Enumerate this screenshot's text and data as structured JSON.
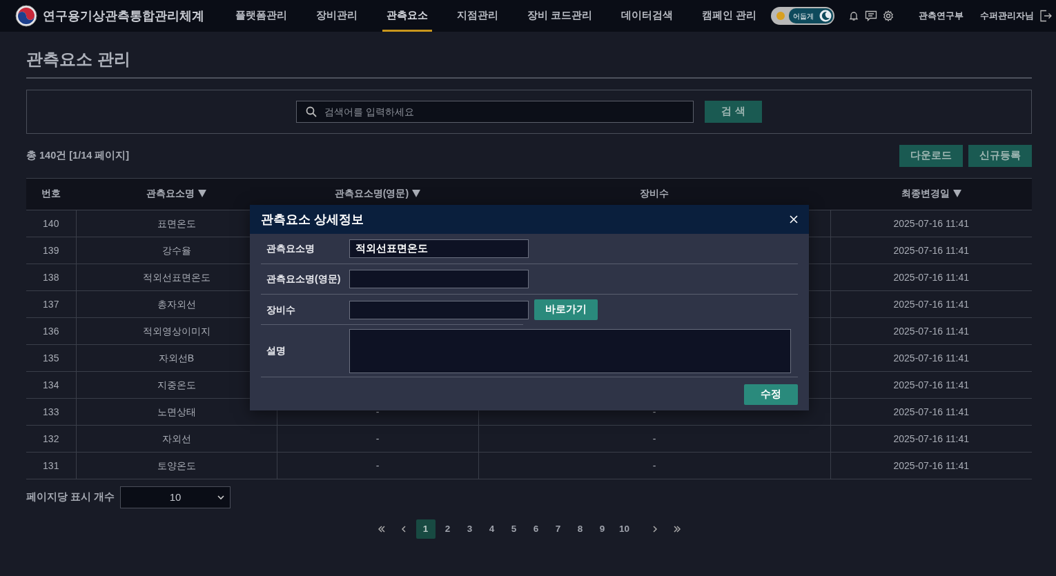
{
  "app": {
    "title": "연구용기상관측통합관리체계"
  },
  "nav": [
    {
      "label": "플랫폼관리",
      "selected": false
    },
    {
      "label": "장비관리",
      "selected": false
    },
    {
      "label": "관측요소",
      "selected": true
    },
    {
      "label": "지점관리",
      "selected": false
    },
    {
      "label": "장비 코드관리",
      "selected": false
    },
    {
      "label": "데이터검색",
      "selected": false
    },
    {
      "label": "캠페인 관리",
      "selected": false
    }
  ],
  "theme_toggle": {
    "label": "어둡게",
    "dark": true
  },
  "user": {
    "department": "관측연구부",
    "name": "수퍼관리자님"
  },
  "page_title": "관측요소 관리",
  "search": {
    "placeholder": "검색어를 입력하세요",
    "button": "검 색"
  },
  "summary": "총 140건 [1/14 페이지]",
  "actions": [
    "다운로드",
    "신규등록"
  ],
  "table": {
    "columns": [
      {
        "label": "번호",
        "sortable": false
      },
      {
        "label": "관측요소명",
        "sortable": true
      },
      {
        "label": "관측요소명(영문)",
        "sortable": true
      },
      {
        "label": "장비수",
        "sortable": false
      },
      {
        "label": "최종변경일",
        "sortable": true
      }
    ],
    "rows": [
      {
        "no": "140",
        "name": "표면온도",
        "updated": "2025-07-16 11:41"
      },
      {
        "no": "139",
        "name": "강수율",
        "updated": "2025-07-16 11:41"
      },
      {
        "no": "138",
        "name": "적외선표면온도",
        "updated": "2025-07-16 11:41"
      },
      {
        "no": "137",
        "name": "총자외선",
        "updated": "2025-07-16 11:41"
      },
      {
        "no": "136",
        "name": "적외영상이미지",
        "updated": "2025-07-16 11:41"
      },
      {
        "no": "135",
        "name": "자외선B",
        "updated": "2025-07-16 11:41"
      },
      {
        "no": "134",
        "name": "지중온도",
        "updated": "2025-07-16 11:41"
      },
      {
        "no": "133",
        "name": "노면상태",
        "name_en": "-",
        "devices": "-",
        "updated": "2025-07-16 11:41"
      },
      {
        "no": "132",
        "name": "자외선",
        "name_en": "-",
        "devices": "-",
        "updated": "2025-07-16 11:41"
      },
      {
        "no": "131",
        "name": "토양온도",
        "name_en": "-",
        "devices": "-",
        "updated": "2025-07-16 11:41"
      }
    ]
  },
  "page_size": {
    "label": "페이지당 표시 개수",
    "value": "10"
  },
  "pagination": [
    {
      "label": "1",
      "selected": true
    },
    {
      "label": "2",
      "selected": false
    },
    {
      "label": "3",
      "selected": false
    },
    {
      "label": "4",
      "selected": false
    },
    {
      "label": "5",
      "selected": false
    },
    {
      "label": "6",
      "selected": false
    },
    {
      "label": "7",
      "selected": false
    },
    {
      "label": "8",
      "selected": false
    },
    {
      "label": "9",
      "selected": false
    },
    {
      "label": "10",
      "selected": false
    }
  ],
  "modal": {
    "title": "관측요소 상세정보",
    "fields": [
      {
        "kind": "input",
        "label": "관측요소명",
        "value": "적외선표면온도"
      },
      {
        "kind": "input",
        "label": "관측요소명(영문)"
      },
      {
        "kind": "input_link",
        "label": "장비수",
        "button": "바로가기"
      },
      {
        "kind": "textarea",
        "label": "설명"
      }
    ],
    "submit": "수정"
  }
}
